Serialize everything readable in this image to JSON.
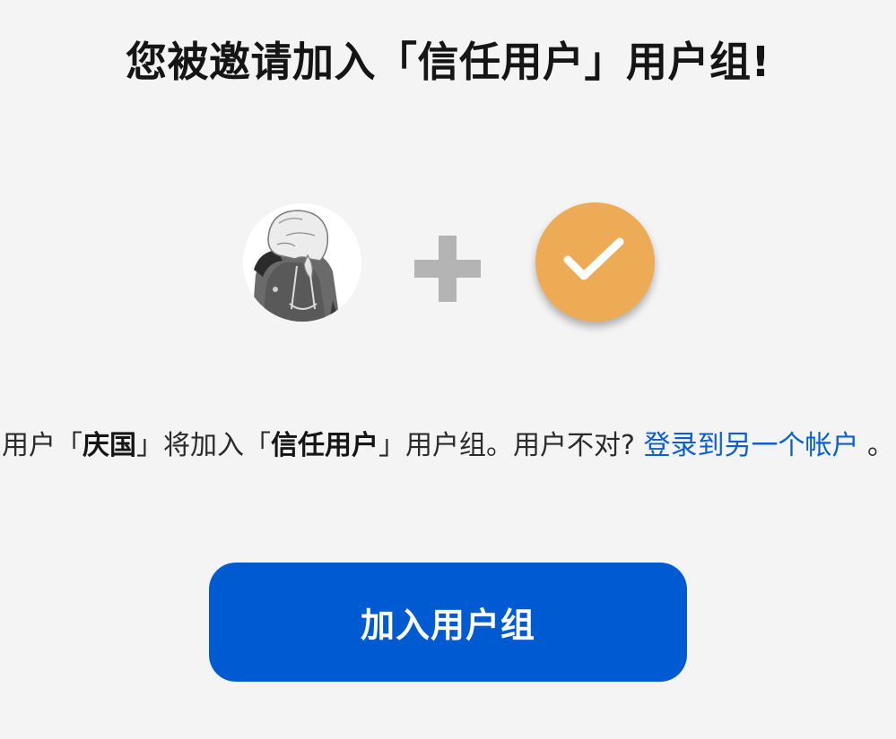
{
  "invite": {
    "title": "您被邀请加入「信任用户」用户组!"
  },
  "icons": {
    "user_avatar": "anime-hooded-girl-avatar",
    "plus": "plus-icon",
    "group_badge": "check-icon"
  },
  "colors": {
    "background": "#f4f4f4",
    "plus": "#b4b4b4",
    "group_badge": "#eeab55",
    "link": "#0a5fd2",
    "button": "#005ad1",
    "button_text": "#ffffff"
  },
  "message": {
    "prefix": "用户「",
    "username": "庆国",
    "middle": "」将加入「",
    "group_name": "信任用户",
    "suffix": "」用户组。用户不对?",
    "switch_account_link": "登录到另一个帐户",
    "end": "。"
  },
  "actions": {
    "join_label": "加入用户组"
  }
}
